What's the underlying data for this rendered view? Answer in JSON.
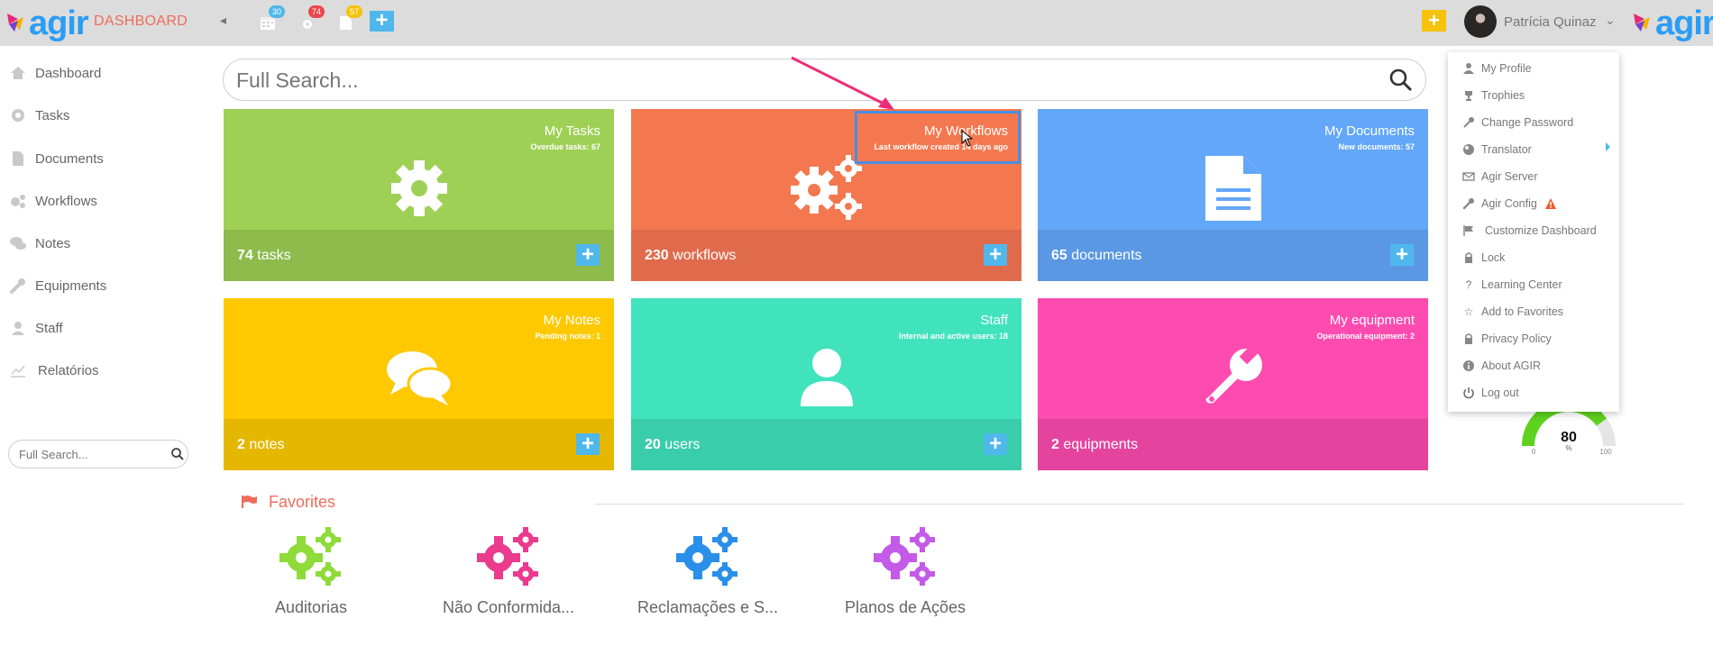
{
  "header": {
    "logo_text": "agir",
    "title": "DASHBOARD",
    "badges": {
      "calendar": "30",
      "workflows": "74",
      "documents": "57"
    },
    "user_name": "Patrícia Quinaz",
    "colors": {
      "brand_blue": "#2a9df4",
      "title_red": "#ef6c5b",
      "plus_blue": "#4fb7ec",
      "plus_yellow": "#f6c20a"
    }
  },
  "sidebar": {
    "items": [
      {
        "label": "Dashboard",
        "icon": "home-icon"
      },
      {
        "label": "Tasks",
        "icon": "gear-icon"
      },
      {
        "label": "Documents",
        "icon": "file-icon"
      },
      {
        "label": "Workflows",
        "icon": "gears-icon"
      },
      {
        "label": "Notes",
        "icon": "comments-icon"
      },
      {
        "label": "Equipments",
        "icon": "wrench-icon"
      },
      {
        "label": "Staff",
        "icon": "user-icon"
      },
      {
        "label": "Relatórios",
        "icon": "chart-icon"
      }
    ],
    "search_placeholder": "Full Search..."
  },
  "main_search": {
    "placeholder": "Full Search..."
  },
  "tiles": [
    {
      "title": "My Tasks",
      "subtitle": "Overdue tasks: 67",
      "count": "74",
      "unit": "tasks",
      "color": "#9ed056",
      "foot_color": "#8ebb4c",
      "icon": "gear-icon"
    },
    {
      "title": "My Workflows",
      "subtitle": "Last workflow created 14 days ago",
      "count": "230",
      "unit": "workflows",
      "color": "#f4784f",
      "foot_color": "#e06b4c",
      "icon": "gears-icon"
    },
    {
      "title": "My Documents",
      "subtitle": "New documents: 57",
      "count": "65",
      "unit": "documents",
      "color": "#63a7f8",
      "foot_color": "#5b98e4",
      "icon": "file-icon"
    },
    {
      "title": "My Notes",
      "subtitle": "Pending notes: 1",
      "count": "2",
      "unit": "notes",
      "color": "#fec900",
      "foot_color": "#e6b700",
      "icon": "comments-icon"
    },
    {
      "title": "Staff",
      "subtitle": "Internal and active users: 18",
      "count": "20",
      "unit": "users",
      "color": "#41e3bd",
      "foot_color": "#3acdaa",
      "icon": "user-icon"
    },
    {
      "title": "My equipment",
      "subtitle": "Operational equipment: 2",
      "count": "2",
      "unit": "equipments",
      "color": "#fe4bb0",
      "foot_color": "#e4449e",
      "icon": "wrench-icon"
    }
  ],
  "favorites": {
    "title": "Favorites",
    "items": [
      {
        "label": "Auditorias",
        "color": "#8edb39"
      },
      {
        "label": "Não Conformida...",
        "color": "#ea3b8e"
      },
      {
        "label": "Reclamações e S...",
        "color": "#2a8fe8"
      },
      {
        "label": "Planos de Ações",
        "color": "#c45ae8"
      }
    ]
  },
  "gauge": {
    "value": "80",
    "unit": "%",
    "min": "0",
    "max": "100",
    "fraction": 0.8
  },
  "user_menu": {
    "items": [
      {
        "label": "My Profile",
        "icon": "user-icon"
      },
      {
        "label": "Trophies",
        "icon": "trophy-icon"
      },
      {
        "label": "Change Password",
        "icon": "key-icon"
      },
      {
        "label": "Translator",
        "icon": "globe-icon"
      },
      {
        "label": "Agir Server",
        "icon": "envelope-icon"
      },
      {
        "label": "Agir Config",
        "icon": "wrench-icon"
      },
      {
        "label": "Customize Dashboard",
        "icon": "flag-icon"
      },
      {
        "label": "Lock",
        "icon": "lock-icon"
      },
      {
        "label": "Learning Center",
        "icon": "question-icon"
      },
      {
        "label": "Add to Favorites",
        "icon": "star-icon"
      },
      {
        "label": "Privacy Policy",
        "icon": "lock-icon"
      },
      {
        "label": "About AGIR",
        "icon": "info-icon"
      },
      {
        "label": "Log out",
        "icon": "power-icon"
      }
    ]
  }
}
